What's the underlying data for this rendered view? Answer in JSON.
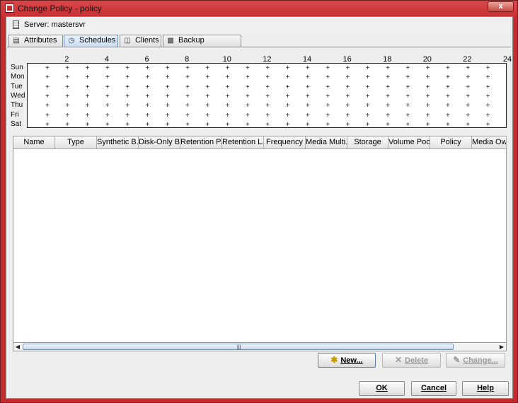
{
  "window": {
    "title": "Change Policy - policy",
    "close_label": "x"
  },
  "server": {
    "label": "Server: mastersvr"
  },
  "tabs": [
    {
      "label": "Attributes",
      "icon": "attributes-icon"
    },
    {
      "label": "Schedules",
      "icon": "schedules-icon"
    },
    {
      "label": "Clients",
      "icon": "clients-icon"
    },
    {
      "label": "Backup Selections",
      "icon": "backup-selections-icon"
    }
  ],
  "calendar": {
    "hours": [
      "2",
      "4",
      "6",
      "8",
      "10",
      "12",
      "14",
      "16",
      "18",
      "20",
      "22",
      "24"
    ],
    "days": [
      "Sun",
      "Mon",
      "Tue",
      "Wed",
      "Thu",
      "Fri",
      "Sat"
    ]
  },
  "table": {
    "columns": [
      "Name",
      "Type",
      "Synthetic B...",
      "Disk-Only B...",
      "Retention P...",
      "Retention L...",
      "Frequency",
      "Media Multi...",
      "Storage",
      "Volume Pool",
      "Policy",
      "Media Own"
    ],
    "rows": []
  },
  "actions": {
    "new": "New...",
    "delete": "Delete",
    "change": "Change..."
  },
  "footer": {
    "ok": "OK",
    "cancel": "Cancel",
    "help": "Help"
  },
  "colors": {
    "title_bar": "#c42c30",
    "active_tab": "#c9dff5",
    "scroll_thumb": "#c6d8ec"
  }
}
